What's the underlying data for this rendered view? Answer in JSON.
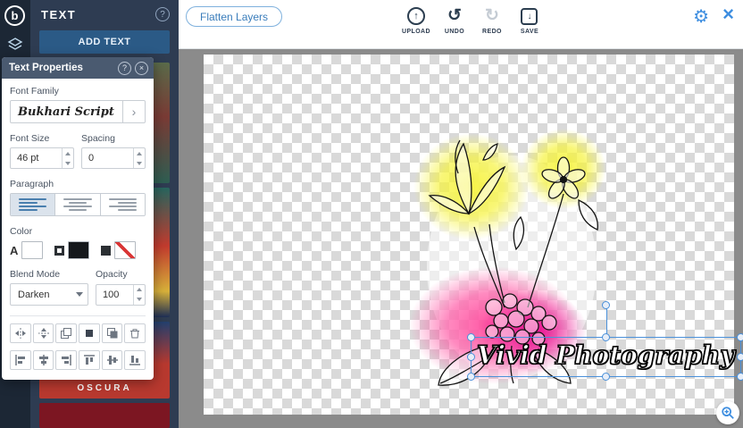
{
  "icons": {
    "logo": "b",
    "help": "?",
    "close": "×",
    "upload_glyph": "↑",
    "undo_glyph": "↺",
    "redo_glyph": "↻",
    "save_glyph": "↓",
    "chevron_right": "›",
    "gear_glyph": "⚙",
    "window_close": "×"
  },
  "sidebar": {
    "title": "TEXT",
    "add_text_button": "ADD TEXT",
    "thumbnail_caption": "OSCURA"
  },
  "topbar": {
    "flatten_button": "Flatten Layers",
    "actions": [
      {
        "label": "UPLOAD"
      },
      {
        "label": "UNDO"
      },
      {
        "label": "REDO"
      },
      {
        "label": "SAVE"
      }
    ]
  },
  "panel": {
    "title": "Text Properties",
    "font_family": {
      "label": "Font Family",
      "value": "Bukhari Script"
    },
    "font_size": {
      "label": "Font Size",
      "value": "46 pt"
    },
    "spacing": {
      "label": "Spacing",
      "value": "0"
    },
    "paragraph": {
      "label": "Paragraph",
      "selected_alignment": "left"
    },
    "color": {
      "label": "Color",
      "text_prefix": "A"
    },
    "blend_mode": {
      "label": "Blend Mode",
      "value": "Darken"
    },
    "opacity": {
      "label": "Opacity",
      "value": "100"
    }
  },
  "canvas": {
    "text_layer": "Vivid Photography"
  },
  "colors": {
    "accent": "#3e8ee0",
    "panel_header": "#4a5a70",
    "sidebar": "#2e3c52",
    "rail": "#1c2735",
    "selection": "#4a90d9",
    "glow_yellow": "#f6f33e",
    "glow_pink": "#ff3d96",
    "glow_magenta": "#e4008c"
  }
}
